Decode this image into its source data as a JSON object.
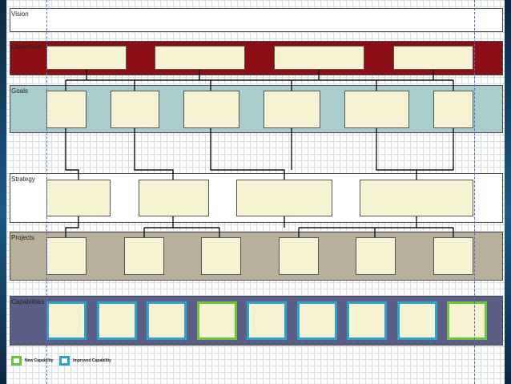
{
  "bands": {
    "vision": {
      "label": "Vision",
      "color": "#ffffff"
    },
    "objectives": {
      "label": "Objectives",
      "color": "#8b0f14"
    },
    "goals": {
      "label": "Goals",
      "color": "#a9cccc"
    },
    "strategy": {
      "label": "Strategy",
      "color": "#ffffff"
    },
    "projects": {
      "label": "Projects",
      "color": "#b8b09a"
    },
    "capabilities": {
      "label": "Capabilities",
      "color": "#5b5e86"
    }
  },
  "capabilities": {
    "states": [
      "improved",
      "improved",
      "improved",
      "new",
      "improved",
      "improved",
      "improved",
      "improved",
      "new"
    ]
  },
  "legend": {
    "new_label": "New Capability",
    "improved_label": "Improved Capability",
    "new_color": "#6ec13a",
    "improved_color": "#2aa3c6"
  },
  "colors": {
    "box_fill": "#f5f3d2",
    "grid_line": "#d7dde4",
    "guide_line": "#5a6cc8"
  }
}
